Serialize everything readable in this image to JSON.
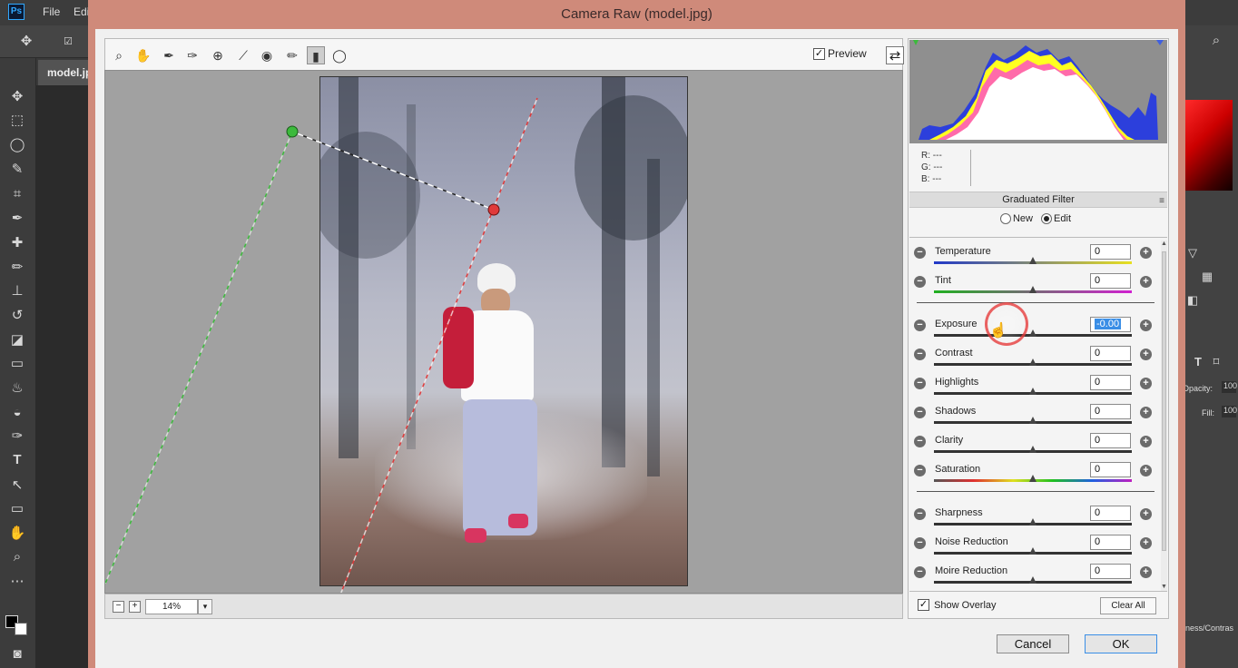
{
  "photoshop": {
    "logo": "Ps",
    "menu": [
      "File",
      "Edi"
    ],
    "document_tab": "model.jp",
    "right_panel": {
      "opacity_label": "Opacity:",
      "opacity_value": "100",
      "fill_label": "Fill:",
      "fill_value": "100",
      "fragment_text": "ness/Contras"
    }
  },
  "camera_raw": {
    "title": "Camera Raw (model.jpg)",
    "preview_label": "Preview",
    "preview_checked": true,
    "zoom": "14%",
    "rgb": {
      "r_label": "R:",
      "r_value": "---",
      "g_label": "G:",
      "g_value": "---",
      "b_label": "B:",
      "b_value": "---"
    },
    "panel": {
      "title": "Graduated Filter",
      "mode_new": "New",
      "mode_edit": "Edit",
      "selected_mode": "Edit",
      "sliders": [
        {
          "label": "Temperature",
          "value": "0",
          "position": 0.5
        },
        {
          "label": "Tint",
          "value": "0",
          "position": 0.5
        },
        {
          "label": "Exposure",
          "value": "-0.00",
          "position": 0.5
        },
        {
          "label": "Contrast",
          "value": "0",
          "position": 0.5
        },
        {
          "label": "Highlights",
          "value": "0",
          "position": 0.5
        },
        {
          "label": "Shadows",
          "value": "0",
          "position": 0.5
        },
        {
          "label": "Clarity",
          "value": "0",
          "position": 0.5
        },
        {
          "label": "Saturation",
          "value": "0",
          "position": 0.5
        },
        {
          "label": "Sharpness",
          "value": "0",
          "position": 0.5
        },
        {
          "label": "Noise Reduction",
          "value": "0",
          "position": 0.5
        },
        {
          "label": "Moire Reduction",
          "value": "0",
          "position": 0.5
        }
      ]
    },
    "show_overlay_label": "Show Overlay",
    "show_overlay_checked": true,
    "clear_all_label": "Clear All",
    "cancel_label": "Cancel",
    "ok_label": "OK"
  },
  "icons": {
    "zoom_out": "−",
    "zoom_in": "+",
    "dropdown": "▾",
    "check": "✓"
  },
  "colors": {
    "overlay_green": "#3cba3c",
    "overlay_red": "#e03a3a",
    "selection_blue": "#3a8ee6"
  }
}
